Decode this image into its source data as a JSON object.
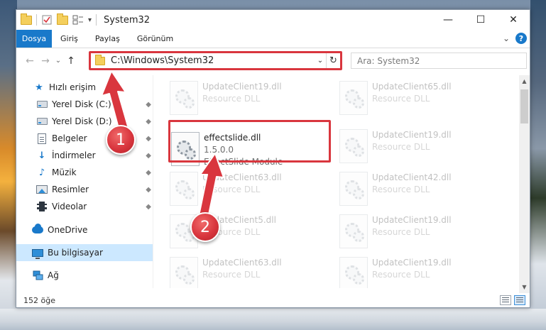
{
  "window": {
    "title": "System32",
    "qat_dropdown": "▾",
    "controls": {
      "minimize": "—",
      "maximize": "☐",
      "close": "✕"
    }
  },
  "ribbon": {
    "tabs": [
      "Dosya",
      "Giriş",
      "Paylaş",
      "Görünüm"
    ],
    "expand": "⌄",
    "help": "?"
  },
  "nav": {
    "back": "←",
    "forward": "→",
    "recent": "⌄",
    "up": "↑"
  },
  "address": {
    "path": "C:\\Windows\\System32",
    "dropdown": "⌄",
    "refresh": "↻"
  },
  "search": {
    "placeholder": "Ara: System32"
  },
  "sidebar": {
    "items": [
      {
        "label": "Hızlı erişim",
        "icon": "star-icon"
      },
      {
        "label": "Yerel Disk (C:)",
        "icon": "drive-icon"
      },
      {
        "label": "Yerel Disk (D:)",
        "icon": "drive-icon"
      },
      {
        "label": "Belgeler",
        "icon": "documents-icon"
      },
      {
        "label": "İndirmeler",
        "icon": "download-icon"
      },
      {
        "label": "Müzik",
        "icon": "music-icon"
      },
      {
        "label": "Resimler",
        "icon": "pictures-icon"
      },
      {
        "label": "Videolar",
        "icon": "videos-icon"
      },
      {
        "label": "OneDrive",
        "icon": "cloud-icon"
      },
      {
        "label": "Bu bilgisayar",
        "icon": "computer-icon"
      },
      {
        "label": "Ağ",
        "icon": "network-icon"
      }
    ],
    "pin": "📌"
  },
  "files": {
    "left": [
      {
        "name": "UpdateClient19.dll",
        "sub": "Resource DLL"
      },
      {
        "name": "effectslide.dll",
        "sub1": "1.5.0.0",
        "sub2": "EffectSlide Module"
      },
      {
        "name": "UpdateClient63.dll",
        "sub": "Resource DLL"
      },
      {
        "name": "UpdateClient5.dll",
        "sub": "Resource DLL"
      },
      {
        "name": "UpdateClient63.dll",
        "sub": "Resource DLL"
      }
    ],
    "right": [
      {
        "name": "UpdateClient65.dll",
        "sub": "Resource DLL"
      },
      {
        "name": "UpdateClient19.dll",
        "sub": "Resource DLL"
      },
      {
        "name": "UpdateClient42.dll",
        "sub": "Resource DLL"
      },
      {
        "name": "UpdateClient19.dll",
        "sub": "Resource DLL"
      },
      {
        "name": "UpdateClient19.dll",
        "sub": "Resource DLL"
      }
    ]
  },
  "status": {
    "count": "152 öğe"
  },
  "annotations": {
    "step1": "1",
    "step2": "2",
    "color": "#d9363e"
  }
}
